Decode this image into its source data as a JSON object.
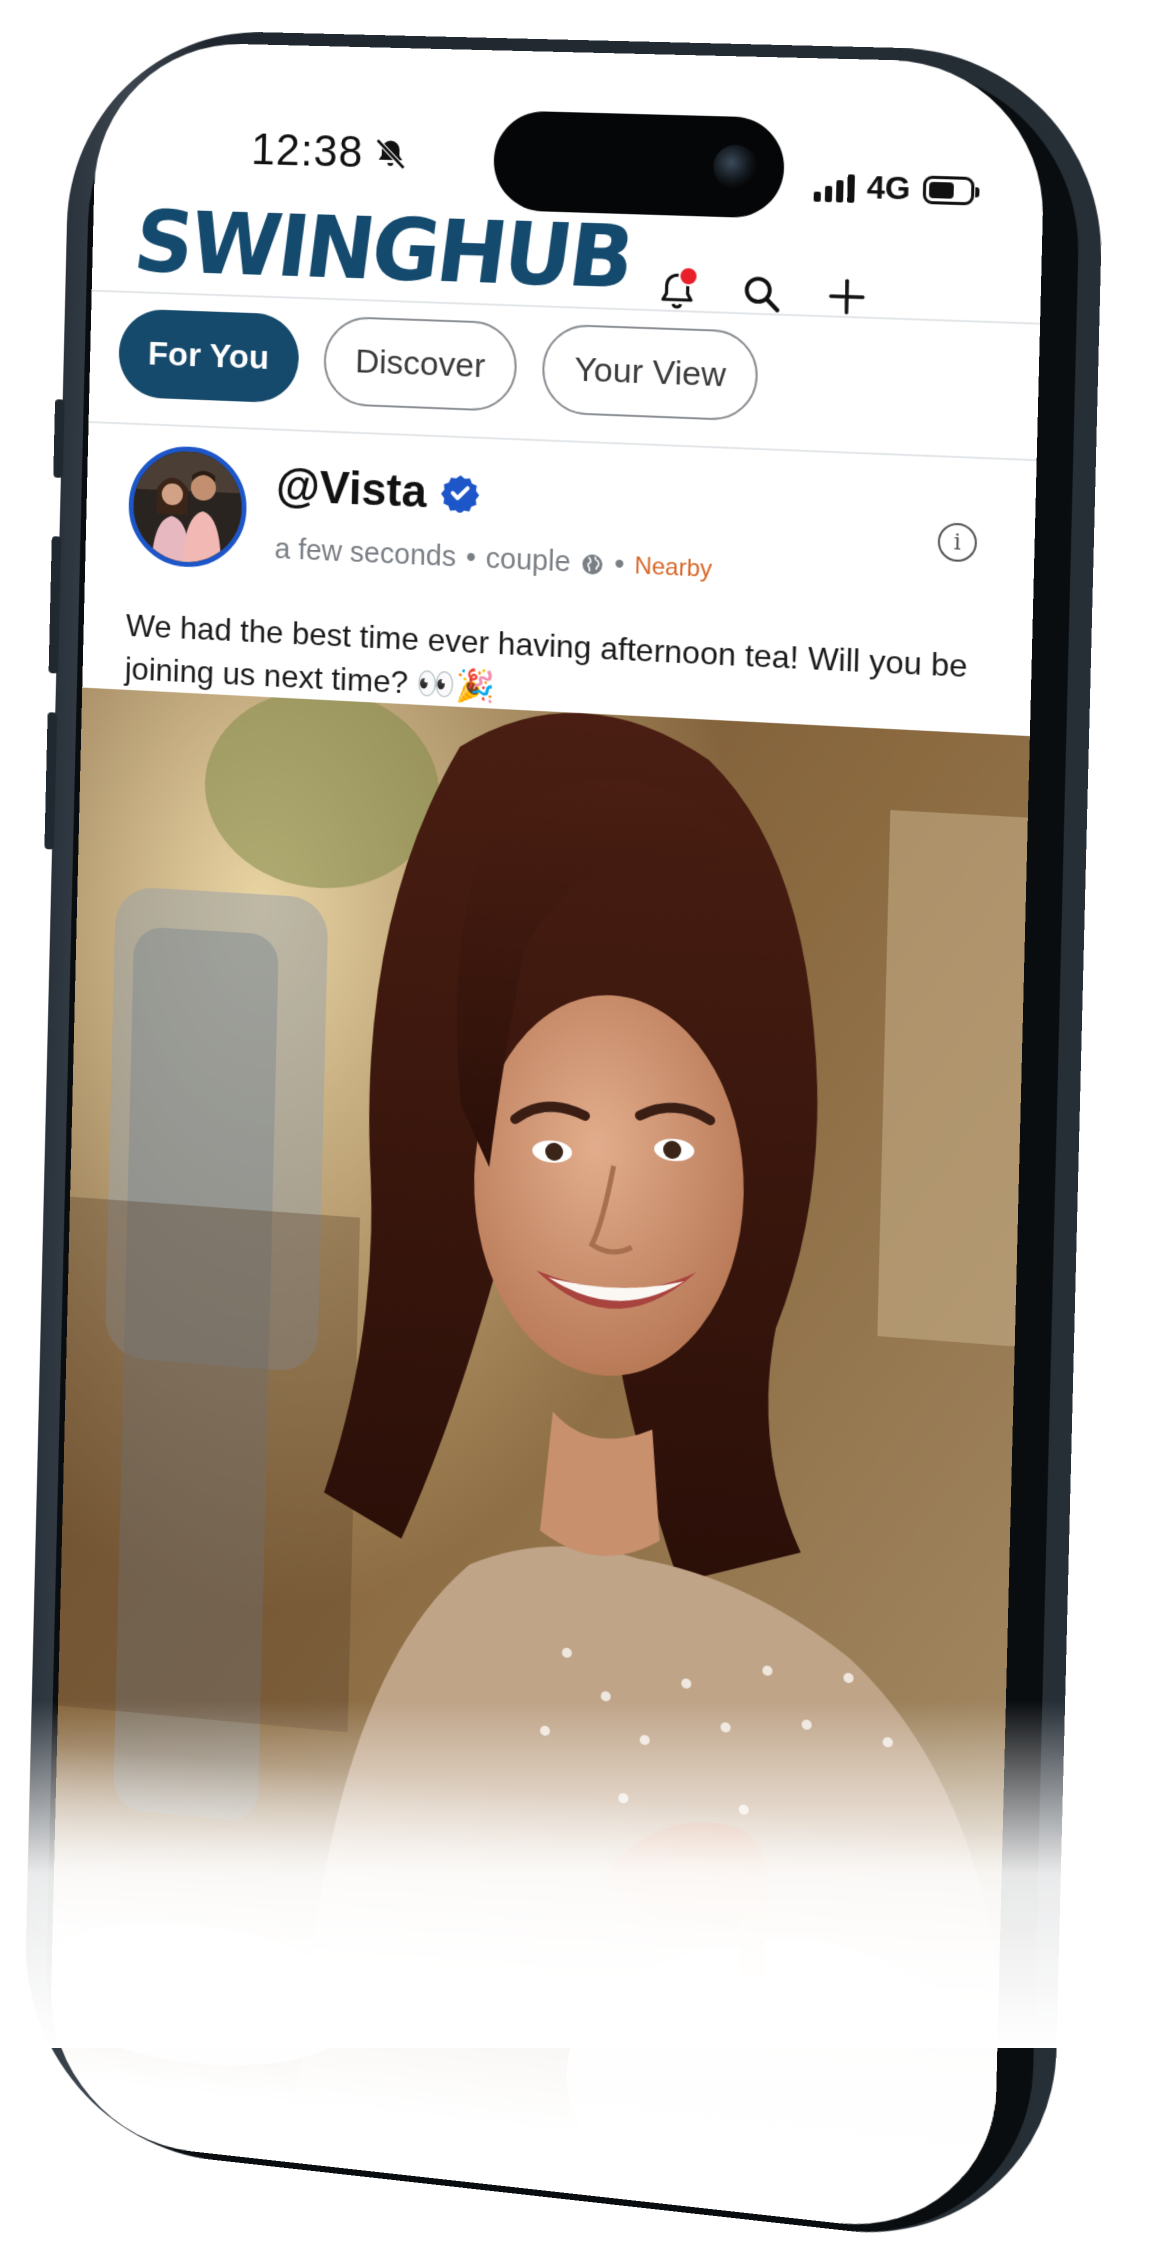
{
  "status_bar": {
    "time": "12:38",
    "network": "4G"
  },
  "app": {
    "logo": "SWINGHUB"
  },
  "header": {
    "icons": [
      "bell-icon",
      "search-icon",
      "plus-icon"
    ],
    "notification_dot_color": "#e8202a"
  },
  "tabs": [
    {
      "label": "For You",
      "active": true
    },
    {
      "label": "Discover",
      "active": false
    },
    {
      "label": "Your View",
      "active": false
    }
  ],
  "post": {
    "username": "@Vista",
    "verified": true,
    "time": "a few seconds",
    "type": "couple",
    "location": "Nearby",
    "caption": "We had the best time ever having afternoon tea! Will you be joining us next time? 👀🎉"
  },
  "colors": {
    "brand": "#144a6e",
    "verified": "#1d56c8",
    "nearby": "#d8682a"
  }
}
